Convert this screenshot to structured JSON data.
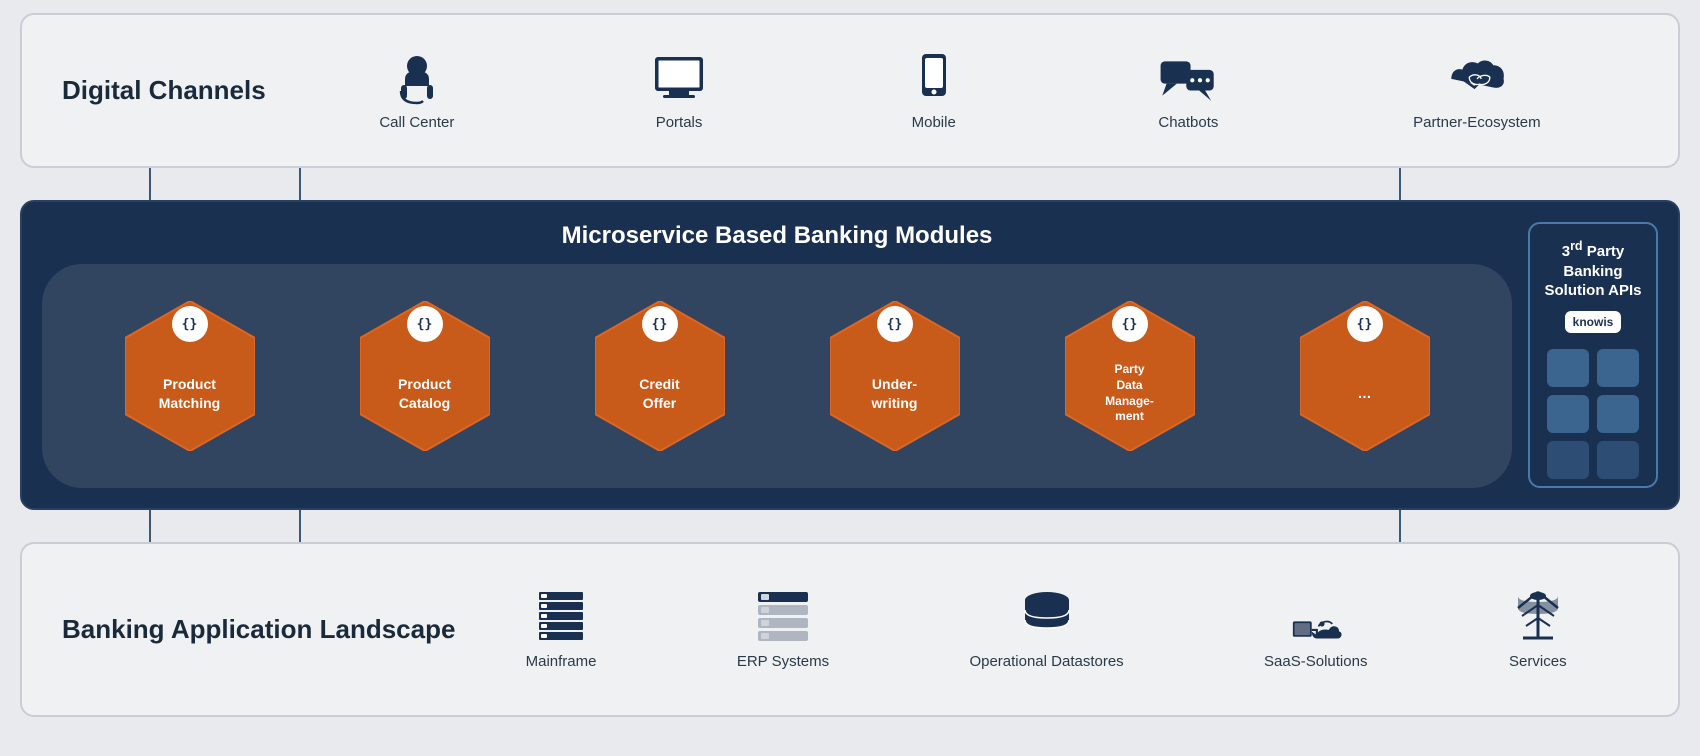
{
  "digital_channels": {
    "title": "Digital Channels",
    "channels": [
      {
        "id": "call-center",
        "label": "Call Center"
      },
      {
        "id": "portals",
        "label": "Portals"
      },
      {
        "id": "mobile",
        "label": "Mobile"
      },
      {
        "id": "chatbots",
        "label": "Chatbots"
      },
      {
        "id": "partner-ecosystem",
        "label": "Partner-Ecosystem"
      }
    ]
  },
  "microservice": {
    "title": "Microservice Based Banking Modules",
    "modules": [
      {
        "id": "product-matching",
        "label": "Product\nMatching",
        "badge": "{}"
      },
      {
        "id": "product-catalog",
        "label": "Product\nCatalog",
        "badge": "{}"
      },
      {
        "id": "credit-offer",
        "label": "Credit\nOffer",
        "badge": "{}"
      },
      {
        "id": "under-writing",
        "label": "Under-\nwriting",
        "badge": "{}"
      },
      {
        "id": "party-data",
        "label": "Party\nData\nManage-\nment",
        "badge": "{}"
      },
      {
        "id": "more",
        "label": "...",
        "badge": "{}"
      }
    ]
  },
  "third_party": {
    "title": "3rd Party Banking Solution APIs",
    "logo": "knowis"
  },
  "banking_landscape": {
    "title": "Banking Application Landscape",
    "items": [
      {
        "id": "mainframe",
        "label": "Mainframe"
      },
      {
        "id": "erp-systems",
        "label": "ERP Systems"
      },
      {
        "id": "operational-datastores",
        "label": "Operational Datastores"
      },
      {
        "id": "saas-solutions",
        "label": "SaaS-Solutions"
      },
      {
        "id": "services",
        "label": "Services"
      }
    ]
  }
}
